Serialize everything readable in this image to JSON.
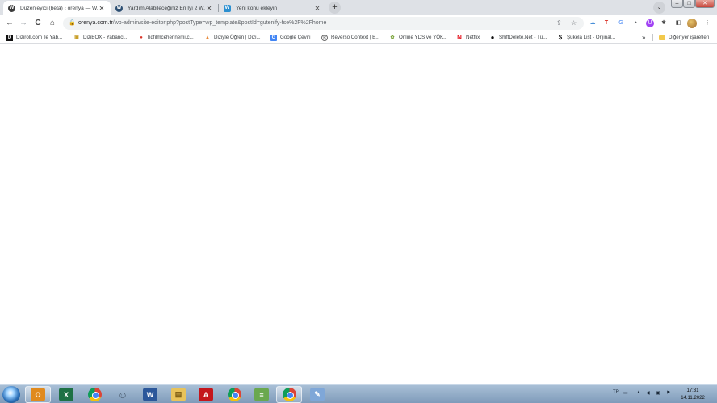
{
  "browser": {
    "tabs": [
      {
        "title": "Düzenleyici (beta) ‹ orenya — W...",
        "icon": "wordpress-icon",
        "active": true
      },
      {
        "title": "Yardım Alabileceğiniz En İyi 2 W...",
        "icon": "wordpress-icon",
        "active": false
      },
      {
        "title": "Yeni konu ekleyin",
        "icon": "forum-icon",
        "active": false
      }
    ],
    "new_tab_label": "+",
    "window_controls": {
      "minimize": "–",
      "maximize": "□",
      "close": "✕"
    }
  },
  "toolbar": {
    "url_host": "orenya.com.tr",
    "url_path": "/wp-admin/site-editor.php?postType=wp_template&postId=gutenify-fse%2F%2Fhome",
    "back_label": "←",
    "forward_label": "→",
    "reload_label": "C",
    "home_label": "⌂"
  },
  "bookmarks": {
    "items": [
      {
        "label": "Diziroll.com ile Yab...",
        "color": "#111111",
        "glyph": "D"
      },
      {
        "label": "DiziBOX - Yabancı...",
        "color": "#c89f2a",
        "glyph": "▣"
      },
      {
        "label": "hdfilmcehennemi.c...",
        "color": "#d9362b",
        "glyph": "●"
      },
      {
        "label": "Diziyle Öğren | Dizi...",
        "color": "#e98a3a",
        "glyph": "▲"
      },
      {
        "label": "Google Çeviri",
        "color": "#4285f4",
        "glyph": "G"
      },
      {
        "label": "Reverso Context | B...",
        "color": "#6b6b6b",
        "glyph": "R"
      },
      {
        "label": "Online YDS ve YÖK...",
        "color": "#7aa33a",
        "glyph": "✿"
      },
      {
        "label": "Netflix",
        "color": "#e50914",
        "glyph": "N"
      },
      {
        "label": "ShiftDelete.Net - Tü...",
        "color": "#111111",
        "glyph": "●"
      },
      {
        "label": "Şukela List - Orijinal...",
        "color": "#222222",
        "glyph": "$"
      }
    ],
    "overflow_label": "»",
    "other_label": "Diğer yer işaretleri"
  },
  "taskbar": {
    "items": [
      {
        "name": "outlook",
        "glyph": "O",
        "color": "#e08a1e",
        "active": true
      },
      {
        "name": "excel",
        "glyph": "X",
        "color": "#1e7145",
        "active": false
      },
      {
        "name": "chrome",
        "glyph": "",
        "color": "",
        "active": false
      },
      {
        "name": "app",
        "glyph": "☺",
        "color": "#5b6b7b",
        "active": false
      },
      {
        "name": "word",
        "glyph": "W",
        "color": "#2b579a",
        "active": false
      },
      {
        "name": "explorer",
        "glyph": "▤",
        "color": "#e8c35a",
        "active": false
      },
      {
        "name": "acrobat",
        "glyph": "A",
        "color": "#c4161c",
        "active": false
      },
      {
        "name": "chrome-alt",
        "glyph": "",
        "color": "",
        "active": false
      },
      {
        "name": "winrar",
        "glyph": "≡",
        "color": "#6aa84f",
        "active": false
      },
      {
        "name": "chrome-active",
        "glyph": "",
        "color": "",
        "active": true
      },
      {
        "name": "paint",
        "glyph": "✎",
        "color": "#7fa7d8",
        "active": false
      }
    ],
    "language": "TR",
    "time": "17:31",
    "date": "14.11.2022"
  },
  "colors": {
    "tabstrip": "#dee1e6",
    "active_tab": "#ffffff",
    "taskbar": "#8fa9c6"
  }
}
